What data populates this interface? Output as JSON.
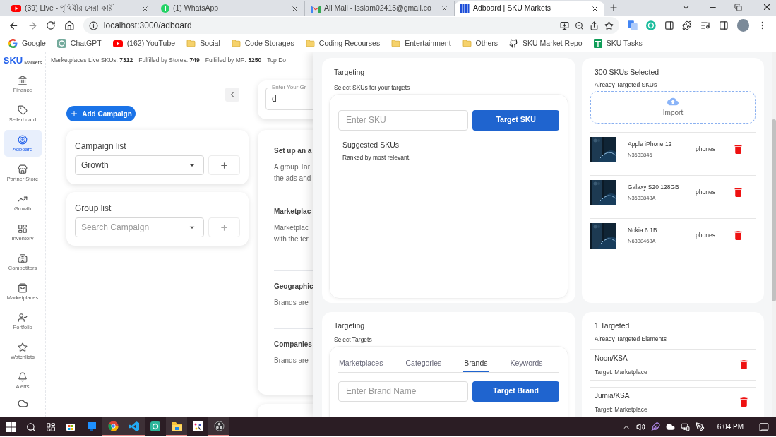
{
  "browser": {
    "tabs": [
      {
        "title": "(39) Live - পৃথিবীর সেরা কারী",
        "kind": "youtube",
        "selected": false
      },
      {
        "title": "(1) WhatsApp",
        "kind": "whatsapp",
        "selected": false
      },
      {
        "title": "All Mail - issiam02415@gmail.co",
        "kind": "gmail",
        "selected": false
      },
      {
        "title": "Adboard | SKU Markets",
        "kind": "app",
        "selected": true
      }
    ],
    "address": "localhost:3000/adboard",
    "bookmarks": [
      {
        "label": "Google",
        "kind": "google"
      },
      {
        "label": "ChatGPT",
        "kind": "chatgpt"
      },
      {
        "label": "(162) YouTube",
        "kind": "youtube"
      },
      {
        "label": "Social",
        "kind": "folder"
      },
      {
        "label": "Code Storages",
        "kind": "folder"
      },
      {
        "label": "Coding Recourses",
        "kind": "folder"
      },
      {
        "label": "Entertainment",
        "kind": "folder"
      },
      {
        "label": "Others",
        "kind": "folder"
      },
      {
        "label": "SKU Market Repo",
        "kind": "github"
      },
      {
        "label": "SKU Tasks",
        "kind": "sheets"
      }
    ]
  },
  "sidebar": {
    "logo": "SKU",
    "logo_sub": "Markets",
    "items": [
      {
        "label": "Finance",
        "selected": false
      },
      {
        "label": "Sellerboard",
        "selected": false
      },
      {
        "label": "Adboard",
        "selected": true
      },
      {
        "label": "Partner Store",
        "selected": false
      },
      {
        "label": "Growth",
        "selected": false
      },
      {
        "label": "Inventory",
        "selected": false
      },
      {
        "label": "Competitors",
        "selected": false
      },
      {
        "label": "Marketplaces",
        "selected": false
      },
      {
        "label": "Portfolio",
        "selected": false
      },
      {
        "label": "Watchlists",
        "selected": false
      },
      {
        "label": "Alerts",
        "selected": false
      }
    ]
  },
  "stats": [
    {
      "label": "Marketplaces Live SKUs:",
      "value": "7312"
    },
    {
      "label": "Fulfilled by Stores:",
      "value": "749"
    },
    {
      "label": "Fulfilled by MP:",
      "value": "3250"
    },
    {
      "label": "Top Do"
    }
  ],
  "campaigns": {
    "add_button": "Add Campaign",
    "campaign_list": {
      "title": "Campaign list",
      "value": "Growth"
    },
    "group_list": {
      "title": "Group list",
      "placeholder": "Search Campaign"
    }
  },
  "group_form": {
    "label": "Enter Your Gr",
    "value": "d"
  },
  "info_sections": [
    {
      "title": "Set up an a",
      "lines": [
        "A group Tar",
        "the ads and"
      ]
    },
    {
      "title": "Marketplac",
      "lines": [
        "Marketplac",
        "with the ter"
      ]
    },
    {
      "title": "Geographic",
      "lines": [
        "Brands are"
      ]
    },
    {
      "title": "Companies",
      "lines": [
        "Brands are"
      ]
    }
  ],
  "sku_targeting": {
    "title": "Targeting",
    "subtitle": "Select SKUs for your targets",
    "placeholder": "Enter SKU",
    "button": "Target SKU",
    "suggested_title": "Suggested SKUs",
    "suggested_subtitle": "Ranked by most relevant."
  },
  "sku_selection": {
    "title": "300 SKUs Selected",
    "subtitle": "Already Targeted SKUs",
    "import": "Import",
    "items": [
      {
        "name": "Apple iPhone 12",
        "sku": "N3633846",
        "category": "phones"
      },
      {
        "name": "Galaxy S20 128GB",
        "sku": "N3633848A",
        "category": "phones"
      },
      {
        "name": "Nokia 6.1B",
        "sku": "N6338468A",
        "category": "phones"
      }
    ]
  },
  "target_picker": {
    "title": "Targeting",
    "subtitle": "Select Targets",
    "tabs": [
      {
        "label": "Marketplaces",
        "selected": false
      },
      {
        "label": "Categories",
        "selected": false
      },
      {
        "label": "Brands",
        "selected": true
      },
      {
        "label": "Keywords",
        "selected": false
      }
    ],
    "placeholder": "Enter Brand Name",
    "button": "Target Brand"
  },
  "targeted": {
    "title": "1 Targeted",
    "subtitle": "Already Targeted Elements",
    "items": [
      {
        "name": "Noon/KSA",
        "target": "Target: Marketplace"
      },
      {
        "name": "Jumia/KSA",
        "target": "Target: Marketplace"
      }
    ]
  },
  "taskbar": {
    "apps": [
      {
        "running": false
      },
      {
        "running": false
      },
      {
        "running": true
      },
      {
        "running": true
      },
      {
        "running": false
      },
      {
        "running": true
      },
      {
        "running": false
      },
      {
        "running": true
      }
    ],
    "time": "6:04 PM"
  }
}
